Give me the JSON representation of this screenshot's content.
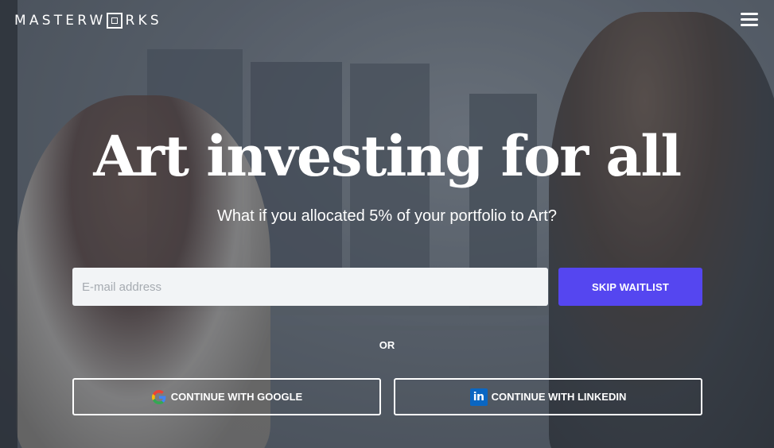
{
  "header": {
    "logo_text_before": "MASTERW",
    "logo_text_after": "RKS",
    "menu_icon": "hamburger-menu-icon"
  },
  "hero": {
    "headline": "Art investing for all",
    "subheadline": "What if you allocated 5% of your portfolio to Art?"
  },
  "signup": {
    "email_placeholder": "E-mail address",
    "email_value": "",
    "skip_waitlist_label": "SKIP WAITLIST",
    "or_label": "OR",
    "google_label": "CONTINUE WITH GOOGLE",
    "google_icon": "google-icon",
    "linkedin_label": "CONTINUE WITH LINKEDIN",
    "linkedin_icon": "linkedin-icon",
    "linkedin_icon_text": "in"
  },
  "colors": {
    "accent": "#5546f0",
    "text": "#ffffff",
    "input_bg": "#f2f4f6",
    "linkedin_blue": "#0a66c2"
  }
}
